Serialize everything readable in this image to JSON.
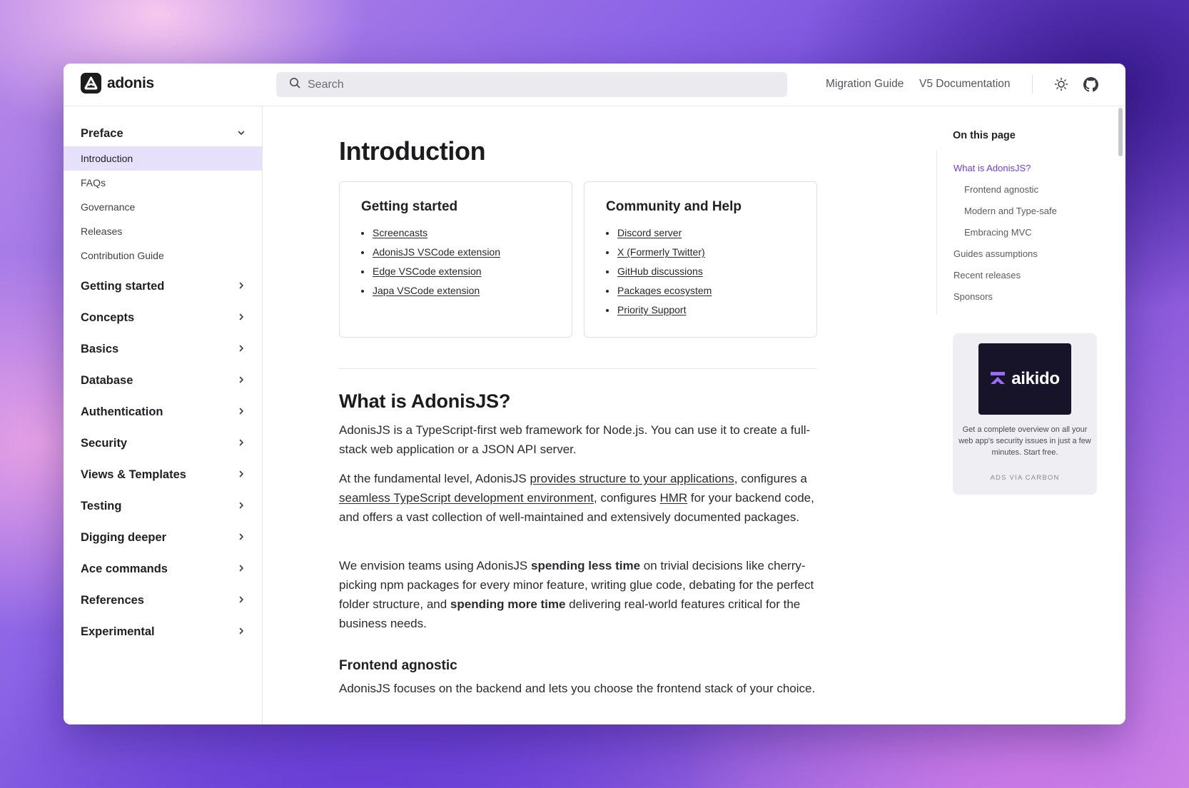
{
  "header": {
    "logo_text": "adonis",
    "search_placeholder": "Search",
    "links": [
      "Migration Guide",
      "V5 Documentation"
    ]
  },
  "sidebar": {
    "preface": {
      "title": "Preface",
      "items": [
        {
          "label": "Introduction",
          "active": true
        },
        {
          "label": "FAQs"
        },
        {
          "label": "Governance"
        },
        {
          "label": "Releases"
        },
        {
          "label": "Contribution Guide"
        }
      ]
    },
    "sections": [
      "Getting started",
      "Concepts",
      "Basics",
      "Database",
      "Authentication",
      "Security",
      "Views & Templates",
      "Testing",
      "Digging deeper",
      "Ace commands",
      "References",
      "Experimental"
    ]
  },
  "main": {
    "title": "Introduction",
    "cards": [
      {
        "title": "Getting started",
        "links": [
          "Screencasts",
          "AdonisJS VSCode extension",
          "Edge VSCode extension",
          "Japa VSCode extension"
        ]
      },
      {
        "title": "Community and Help",
        "links": [
          "Discord server",
          "X (Formerly Twitter)",
          "GitHub discussions",
          "Packages ecosystem",
          "Priority Support"
        ]
      }
    ],
    "what_is_heading": "What is AdonisJS?",
    "p1": "AdonisJS is a TypeScript-first web framework for Node.js. You can use it to create a full-stack web application or a JSON API server.",
    "p2": {
      "a": "At the fundamental level, AdonisJS ",
      "link1": "provides structure to your applications",
      "b": ", configures a ",
      "link2": "seamless TypeScript development environment",
      "c": ", configures ",
      "link3": "HMR",
      "d": " for your backend code, and offers a vast collection of well-maintained and extensively documented packages."
    },
    "p3": {
      "a": "We envision teams using AdonisJS ",
      "bold1": "spending less time",
      "b": " on trivial decisions like cherry-picking npm packages for every minor feature, writing glue code, debating for the perfect folder structure, and ",
      "bold2": "spending more time",
      "c": " delivering real-world features critical for the business needs."
    },
    "frontend_heading": "Frontend agnostic",
    "p4": "AdonisJS focuses on the backend and lets you choose the frontend stack of your choice."
  },
  "toc": {
    "title": "On this page",
    "items": [
      {
        "label": "What is AdonisJS?",
        "active": true,
        "indent": false
      },
      {
        "label": "Frontend agnostic",
        "indent": true
      },
      {
        "label": "Modern and Type-safe",
        "indent": true
      },
      {
        "label": "Embracing MVC",
        "indent": true
      },
      {
        "label": "Guides assumptions",
        "indent": false
      },
      {
        "label": "Recent releases",
        "indent": false
      },
      {
        "label": "Sponsors",
        "indent": false
      }
    ]
  },
  "ad": {
    "brand": "aikido",
    "text": "Get a complete overview on all your web app's security issues in just a few minutes. Start free.",
    "via": "ADS VIA CARBON"
  },
  "colors": {
    "accent": "#6a3fd6",
    "active_bg": "#e6e0fb"
  }
}
